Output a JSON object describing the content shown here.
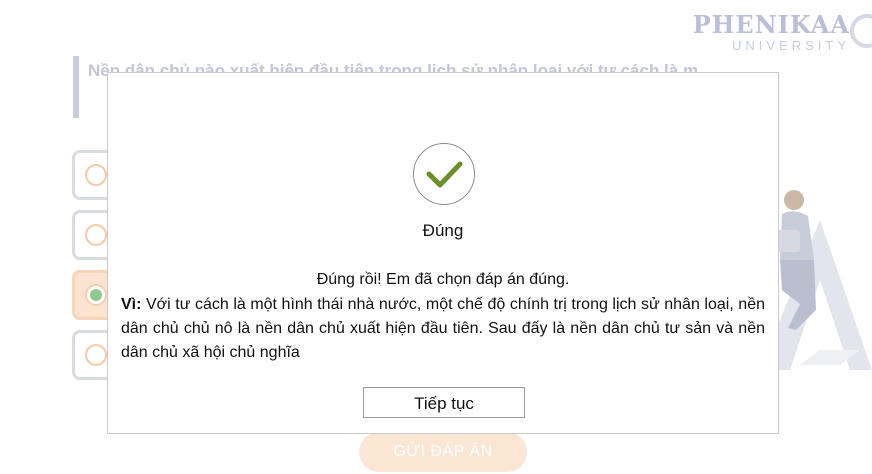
{
  "logo": {
    "name": "PHENIKAA",
    "sub": "UNIVERSITY"
  },
  "question": {
    "text": "Nền dân chủ nào xuất hiện đầu tiên trong lịch sử nhân loại với tư cách là m"
  },
  "options": [
    {
      "selected": false
    },
    {
      "selected": false
    },
    {
      "selected": true
    },
    {
      "selected": false
    }
  ],
  "submit_label": "GỬI ĐÁP ÁN",
  "modal": {
    "status_icon": "check-icon",
    "title": "Đúng",
    "message": "Đúng rồi! Em đã chọn đáp án đúng.",
    "explanation_label": "Vì:",
    "explanation": " Với tư cách là một hình thái nhà nước, một chế độ chính trị trong lịch sử nhân loại, nền dân chủ chủ nô là nền dân chủ xuất hiện đầu tiên. Sau đấy là nền dân chủ tư sản và nền dân chủ xã hội chủ nghĩa",
    "continue_label": "Tiếp tục"
  },
  "colors": {
    "check": "#6b8f2a",
    "accent": "#f4a46b"
  }
}
